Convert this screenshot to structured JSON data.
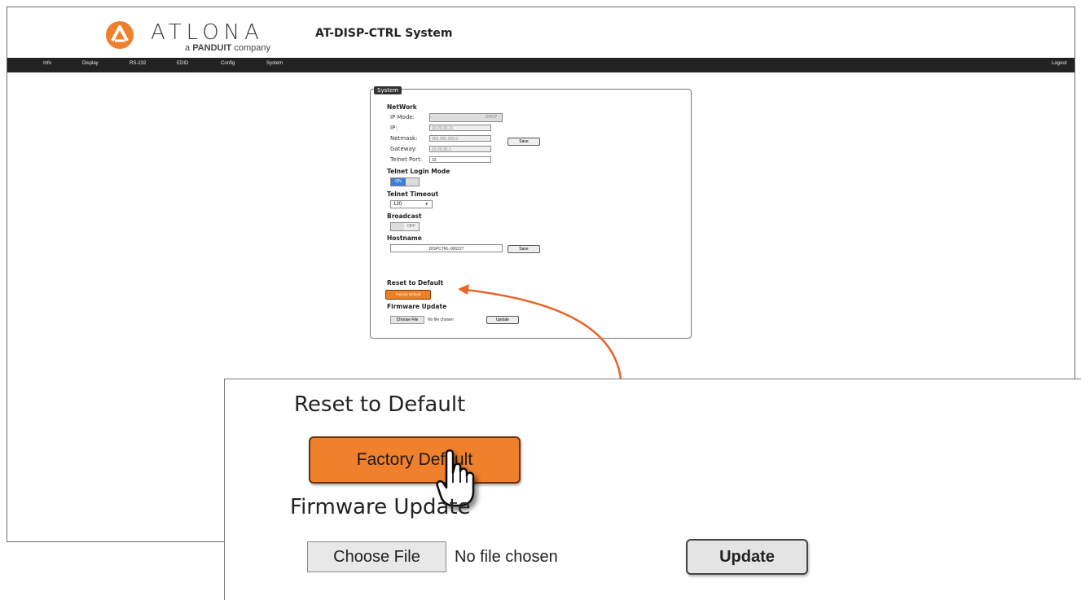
{
  "header": {
    "brand": "ATLONA",
    "brand_sub_a": "a",
    "brand_sub_b": "PANDUIT",
    "brand_sub_c": "company",
    "title": "AT-DISP-CTRL  System"
  },
  "nav": {
    "items": [
      "Info",
      "Display",
      "RS-232",
      "EDID",
      "Config",
      "System"
    ],
    "logout": "Logout"
  },
  "panel": {
    "tab": "System",
    "network": {
      "heading": "NetWork",
      "ip_mode_label": "IP Mode:",
      "ip_mode_value": "DHCP",
      "ip_label": "IP:",
      "ip_value": "10.20.20.21",
      "netmask_label": "Netmask:",
      "netmask_value": "255.255.255.0",
      "gateway_label": "Gateway:",
      "gateway_value": "10.20.20.1",
      "telnet_port_label": "Telnet Port:",
      "telnet_port_value": "23",
      "save_label": "Save"
    },
    "telnet_login": {
      "heading": "Telnet Login Mode",
      "on_label": "ON"
    },
    "telnet_timeout": {
      "heading": "Telnet Timeout",
      "value": "120"
    },
    "broadcast": {
      "heading": "Broadcast",
      "off_label": "OFF"
    },
    "hostname": {
      "heading": "Hostname",
      "value": "DISPCTRL-000227",
      "save_label": "Save"
    },
    "reset": {
      "heading": "Reset to Default",
      "button_label": "Factory Default"
    },
    "firmware": {
      "heading": "Firmware Update",
      "choose_label": "Choose File",
      "no_file": "No file chosen",
      "update_label": "Update"
    }
  },
  "zoom": {
    "reset_heading": "Reset to Default",
    "factory_default_label": "Factory Default",
    "firmware_heading": "Firmware Update",
    "choose_label": "Choose File",
    "no_file": "No file chosen",
    "update_label": "Update"
  },
  "colors": {
    "accent_orange": "#f0802b",
    "nav_bg": "#222222",
    "toggle_on": "#3d7dd6",
    "callout_arrow": "#e8642a"
  },
  "icons": [
    "atlona-logo-icon",
    "pointer-hand-icon",
    "callout-arrow-icon",
    "select-chevron-icon"
  ]
}
